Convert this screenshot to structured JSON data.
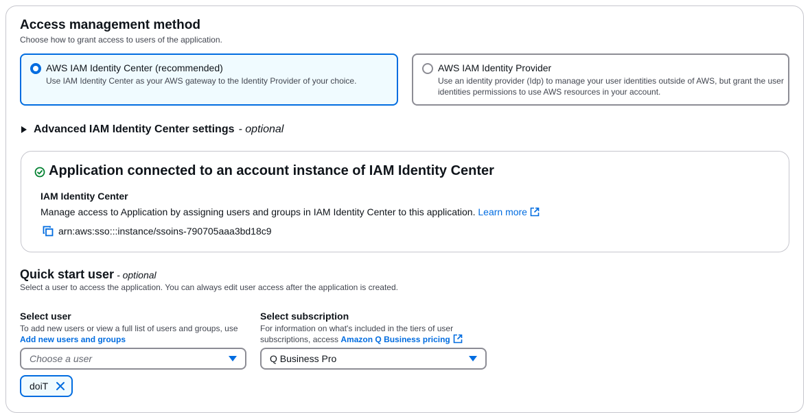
{
  "access": {
    "title": "Access management method",
    "description": "Choose how to grant access to users of the application.",
    "options": [
      {
        "label": "AWS IAM Identity Center (recommended)",
        "description": "Use IAM Identity Center as your AWS gateway to the Identity Provider of your choice.",
        "selected": true
      },
      {
        "label": "AWS IAM Identity Provider",
        "description": "Use an identity provider (Idp) to manage your user identities outside of AWS, but grant the user identities permissions to use AWS resources in your account.",
        "selected": false
      }
    ]
  },
  "advanced": {
    "label": "Advanced IAM Identity Center settings",
    "optional": "- optional"
  },
  "connection": {
    "title": "Application connected to an account instance of IAM Identity Center",
    "section_label": "IAM Identity Center",
    "description": "Manage access to Application by assigning users and groups in IAM Identity Center to this application.",
    "learn_more": "Learn more",
    "arn": "arn:aws:sso:::instance/ssoins-790705aaa3bd18c9"
  },
  "quick_start": {
    "title": "Quick start user",
    "optional": "- optional",
    "description": "Select a user to access the application. You can always edit user access after the application is created.",
    "select_user": {
      "label": "Select user",
      "description": "To add new users or view a full list of users and groups, use",
      "link": "Add new users and groups",
      "placeholder": "Choose a user"
    },
    "select_subscription": {
      "label": "Select subscription",
      "description": "For information on what's included in the tiers of user subscriptions, access",
      "link": "Amazon Q Business pricing",
      "value": "Q Business Pro"
    },
    "tokens": [
      {
        "label": "doiT"
      }
    ]
  },
  "colors": {
    "accent": "#006ce0",
    "success": "#00802f",
    "selected_bg": "#f0fbff"
  }
}
